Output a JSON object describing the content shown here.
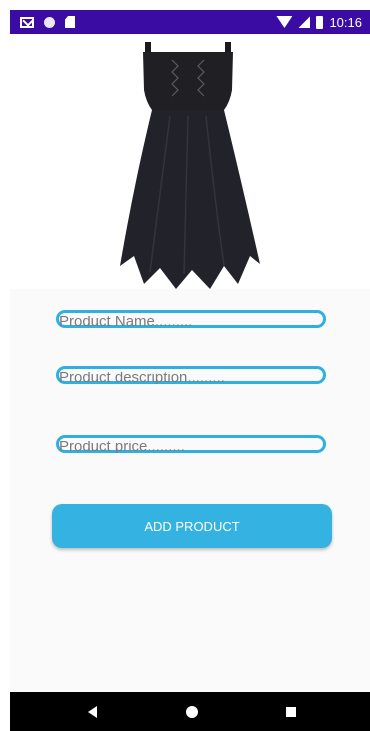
{
  "status_bar": {
    "time": "10:16",
    "icons": [
      "mail-icon",
      "circle-icon",
      "sd-card-icon",
      "wifi-icon",
      "signal-icon",
      "battery-icon"
    ]
  },
  "product_image": {
    "subject": "black dress"
  },
  "form": {
    "name_placeholder": "Product Name.........",
    "description_placeholder": "Product description.........",
    "price_placeholder": "Product price.........",
    "submit_label": "ADD PRODUCT"
  },
  "colors": {
    "status_bar": "#3a0ca3",
    "accent": "#34b3e2",
    "field_border": "#2fb0e0",
    "background": "#fafafa",
    "nav_bar": "#000000"
  },
  "nav_bar": {
    "icons": [
      "back-icon",
      "home-icon",
      "recents-icon"
    ]
  }
}
